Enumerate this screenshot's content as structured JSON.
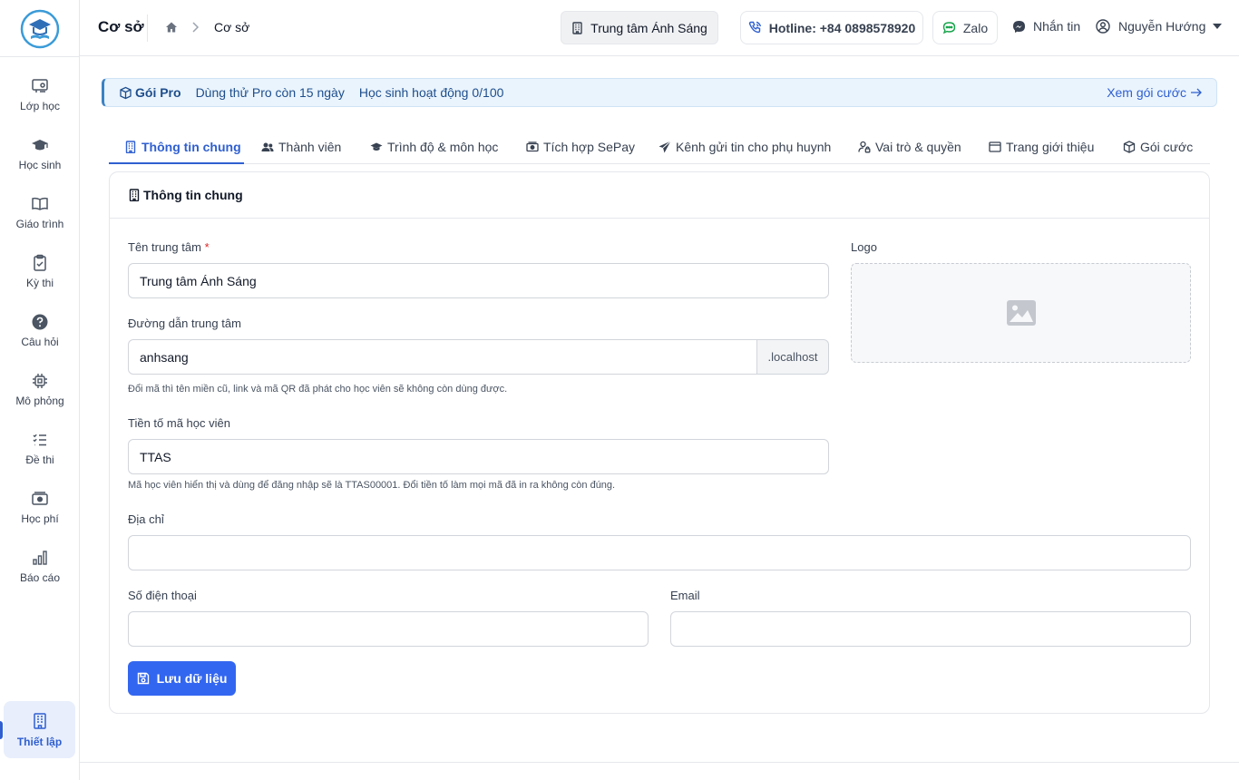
{
  "sidebar": {
    "items": [
      {
        "label": "Lớp học",
        "icon": "classroom-icon"
      },
      {
        "label": "Học sinh",
        "icon": "graduation-cap-icon"
      },
      {
        "label": "Giáo trình",
        "icon": "book-icon"
      },
      {
        "label": "Kỳ thi",
        "icon": "clipboard-check-icon"
      },
      {
        "label": "Câu hỏi",
        "icon": "question-circle-icon"
      },
      {
        "label": "Mô phỏng",
        "icon": "chip-icon"
      },
      {
        "label": "Đề thi",
        "icon": "list-check-icon"
      },
      {
        "label": "Học phí",
        "icon": "money-icon"
      },
      {
        "label": "Báo cáo",
        "icon": "bar-chart-icon"
      }
    ],
    "active": {
      "label": "Thiết lập",
      "icon": "building-icon"
    }
  },
  "header": {
    "title": "Cơ sở",
    "breadcrumb": "Cơ sở",
    "center_name": "Trung tâm Ánh Sáng",
    "hotline": "Hotline: +84 0898578920",
    "zalo": "Zalo",
    "message": "Nhắn tin",
    "user_name": "Nguyễn Hướng"
  },
  "banner": {
    "title": "Gói Pro",
    "trial": "Dùng thử Pro còn 15 ngày",
    "active_students": "Học sinh hoạt động 0/100",
    "link": "Xem gói cước"
  },
  "tabs": [
    {
      "label": "Thông tin chung",
      "icon": "building-icon",
      "active": true
    },
    {
      "label": "Thành viên",
      "icon": "users-icon"
    },
    {
      "label": "Trình độ & môn học",
      "icon": "graduation-cap-icon"
    },
    {
      "label": "Tích hợp SePay",
      "icon": "money-icon"
    },
    {
      "label": "Kênh gửi tin cho phụ huynh",
      "icon": "paper-plane-icon"
    },
    {
      "label": "Vai trò & quyền",
      "icon": "user-lock-icon"
    },
    {
      "label": "Trang giới thiệu",
      "icon": "window-icon"
    },
    {
      "label": "Gói cước",
      "icon": "box-icon"
    }
  ],
  "form": {
    "section_title": "Thông tin chung",
    "name_label": "Tên trung tâm",
    "required_mark": "*",
    "name_value": "Trung tâm Ánh Sáng",
    "slug_label": "Đường dẫn trung tâm",
    "slug_value": "anhsang",
    "slug_suffix": ".localhost",
    "slug_help": "Đổi mã thì tên miền cũ, link và mã QR đã phát cho học viên sẽ không còn dùng được.",
    "prefix_label": "Tiền tố mã học viên",
    "prefix_value": "TTAS",
    "prefix_help": "Mã học viên hiển thị và dùng để đăng nhập sẽ là TTAS00001. Đổi tiền tố làm mọi mã đã in ra không còn đúng.",
    "address_label": "Địa chỉ",
    "address_value": "",
    "phone_label": "Số điện thoại",
    "phone_value": "",
    "email_label": "Email",
    "email_value": "",
    "logo_label": "Logo",
    "save_label": "Lưu dữ liệu"
  },
  "colors": {
    "accent": "#2f5fd0",
    "primary_button": "#3366f0",
    "banner_bg": "#eaf4fd",
    "required": "#dc2626"
  }
}
